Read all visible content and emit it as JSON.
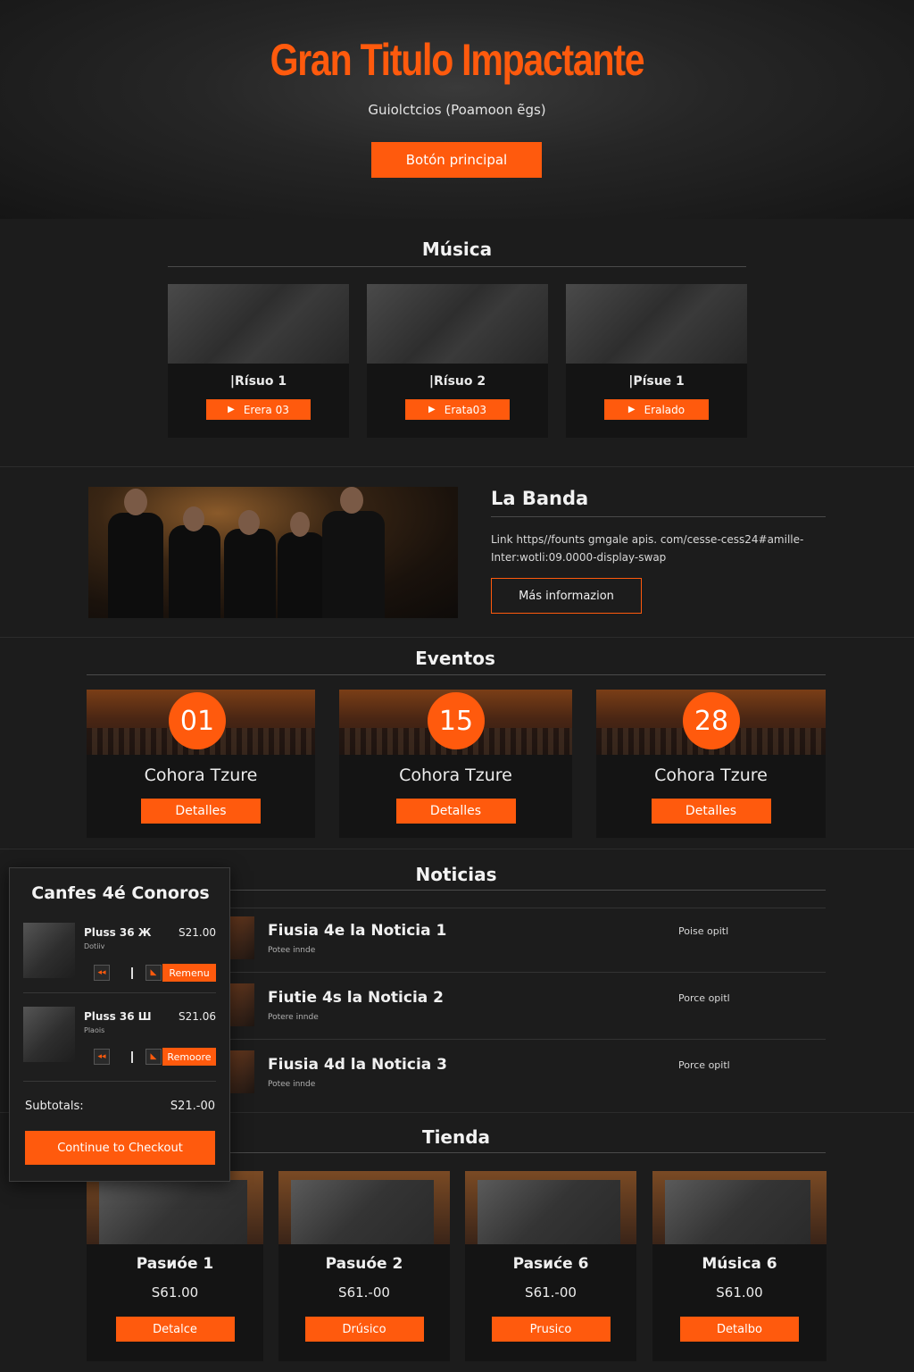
{
  "hero": {
    "title": "Gran Titulo Impactante",
    "subtitle": "Guiolctcios (Poamoon ẽgs)",
    "button": "Botón principal"
  },
  "music": {
    "title": "Música",
    "items": [
      {
        "name": "|Rísuo 1",
        "button": "Erera 03"
      },
      {
        "name": "|Rísuo 2",
        "button": "Erata03"
      },
      {
        "name": "|Písue 1",
        "button": "Eralado"
      }
    ]
  },
  "band": {
    "title": "La Banda",
    "text_line1": "Link https//founts gmgale apis. com/cesse-cess24#amille-",
    "text_line2": "Inter:wotli:09.0000-display-swap",
    "button": "Más informazion"
  },
  "events": {
    "title": "Eventos",
    "items": [
      {
        "day": "01",
        "name": "Cohora Tzure",
        "button": "Detalles"
      },
      {
        "day": "15",
        "name": "Cohora Tzure",
        "button": "Detalles"
      },
      {
        "day": "28",
        "name": "Cohora Tzure",
        "button": "Detalles"
      }
    ]
  },
  "news": {
    "title": "Noticias",
    "items": [
      {
        "title": "Fiusia 4e la Noticia 1",
        "meta": "Potee innde",
        "read": "Poise opitl"
      },
      {
        "title": "Fiutie 4s la Noticia 2",
        "meta": "Potere innde",
        "read": "Porce opitl"
      },
      {
        "title": "Fiusia 4d la Noticia 3",
        "meta": "Potee innde",
        "read": "Porce opitl"
      }
    ]
  },
  "cart": {
    "title": "Canfes 4é Conoros",
    "items": [
      {
        "name": "Pluss 36 Ж",
        "price": "S21.00",
        "sub": "Dotiiv",
        "remove": "Remenu"
      },
      {
        "name": "Pluss 36 Ш",
        "price": "S21.06",
        "sub": "Plaois",
        "remove": "Remoore"
      }
    ],
    "subtotal_label": "Subtotals:",
    "subtotal_value": "S21.-00",
    "checkout": "Continue to Checkout"
  },
  "shop": {
    "title": "Tienda",
    "items": [
      {
        "name": "Pasиóe 1",
        "price": "S61.00",
        "button": "Detalce"
      },
      {
        "name": "Pasuóe 2",
        "price": "S61.-00",
        "button": "Drúsico"
      },
      {
        "name": "Pasиće 6",
        "price": "S61.-00",
        "button": "Prusico"
      },
      {
        "name": "Música 6",
        "price": "S61.00",
        "button": "Detalbo"
      }
    ]
  },
  "colors": {
    "accent": "#ff5a0d",
    "background": "#1c1c1c",
    "card": "#141414"
  }
}
